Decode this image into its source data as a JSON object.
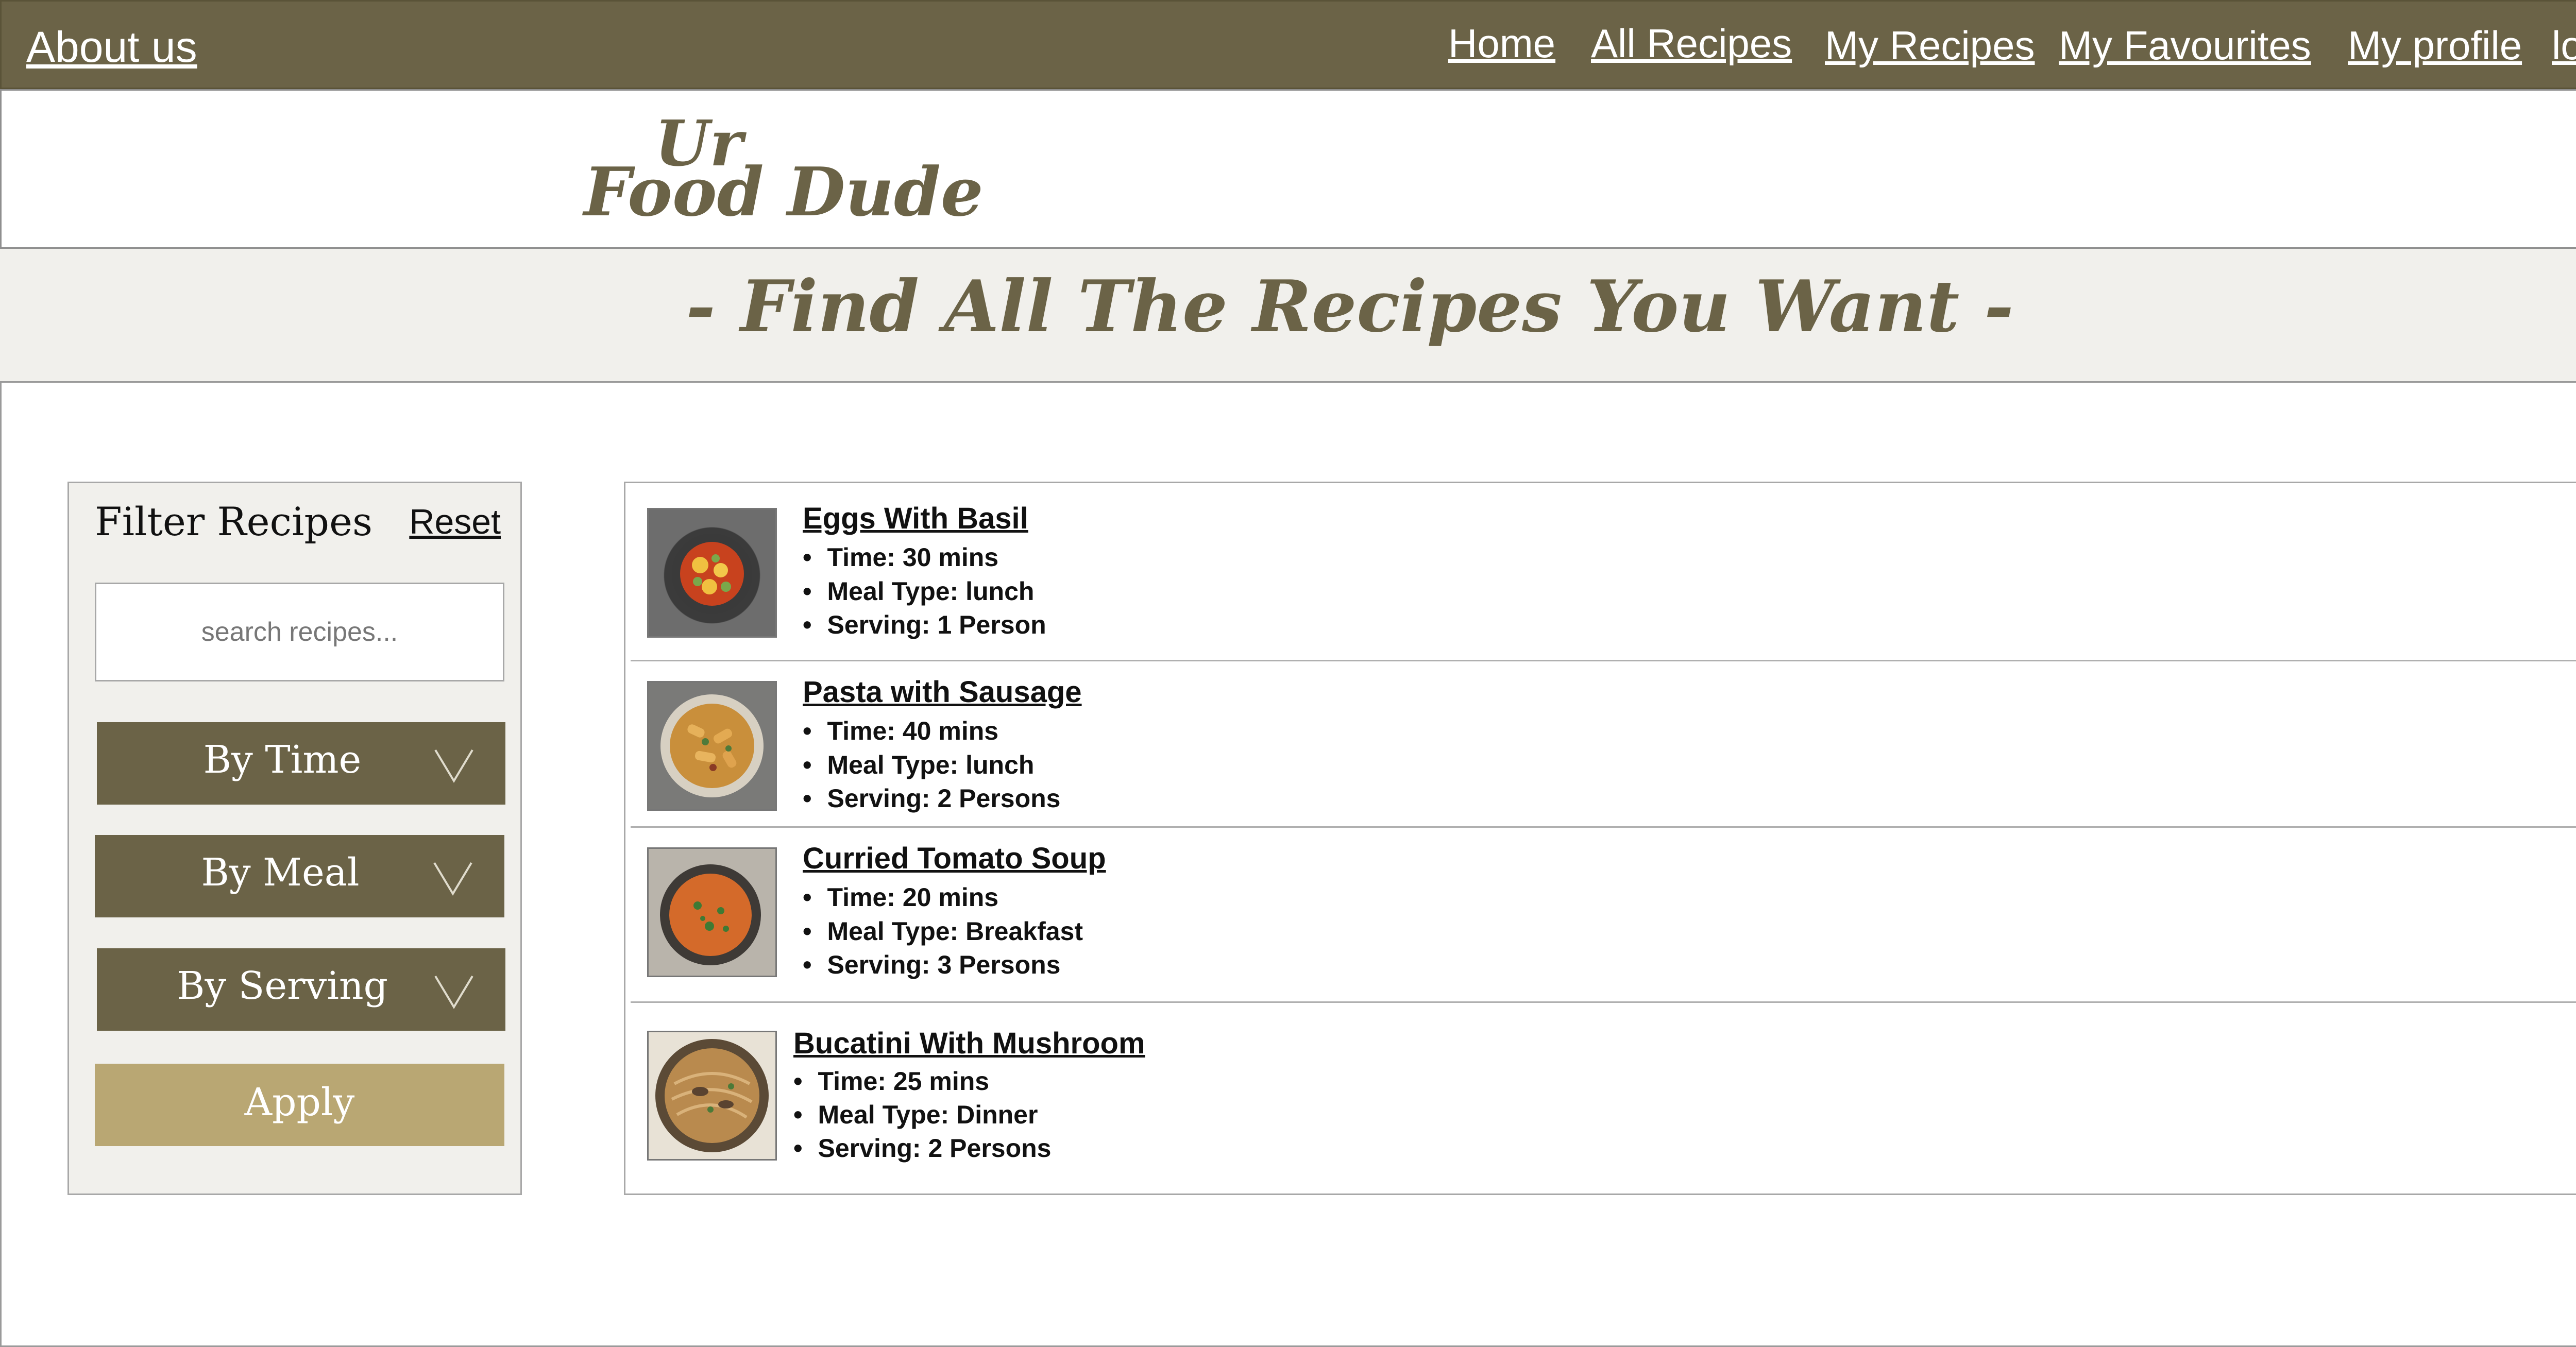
{
  "nav": {
    "about_label": "About us",
    "links": [
      "Home",
      "All Recipes",
      "My Recipes",
      "My Favourites",
      "My profile",
      "log out"
    ]
  },
  "brand": {
    "line1": "Ur",
    "line2": "Food Dude"
  },
  "tagline": "- Find All The Recipes You Want -",
  "filter": {
    "title": "Filter Recipes",
    "reset_label": "Reset",
    "search_placeholder": "search recipes...",
    "by_time_label": "By Time",
    "by_meal_label": "By Meal",
    "by_serving_label": "By Serving",
    "apply_label": "Apply"
  },
  "recipes": [
    {
      "title": "Eggs With Basil",
      "time": "Time: 30  mins",
      "meal": "Meal Type: lunch",
      "serving": "Serving: 1 Person",
      "image_icon": "egg-curry-dish-image"
    },
    {
      "title": "Pasta with Sausage",
      "time": "Time: 40  mins",
      "meal": "Meal Type: lunch",
      "serving": "Serving: 2 Persons",
      "image_icon": "rigatoni-pasta-image"
    },
    {
      "title": "Curried Tomato Soup",
      "time": "Time: 20  mins",
      "meal": "Meal Type: Breakfast",
      "serving": "Serving: 3 Persons",
      "image_icon": "tomato-soup-image"
    },
    {
      "title": "Bucatini With Mushroom",
      "time": "Time: 25  mins",
      "meal": "Meal Type: Dinner",
      "serving": "Serving: 2 Persons",
      "image_icon": "bucatini-mushroom-image"
    }
  ],
  "colors": {
    "brand_olive": "#6b6347",
    "panel_beige": "#f1f0ec",
    "apply_gold": "#b9a773"
  }
}
